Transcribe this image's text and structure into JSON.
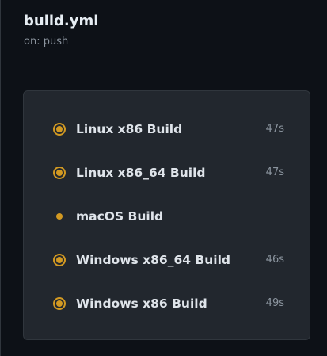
{
  "workflow": {
    "title": "build.yml",
    "trigger": "on: push"
  },
  "colors": {
    "status_in_progress": "#d29922",
    "page_background": "#0d1117",
    "card_background": "#22272e"
  },
  "jobs": [
    {
      "name": "Linux x86 Build",
      "duration": "47s",
      "status_icon": "in-progress-ring-icon"
    },
    {
      "name": "Linux x86_64 Build",
      "duration": "47s",
      "status_icon": "in-progress-ring-icon"
    },
    {
      "name": "macOS Build",
      "duration": "",
      "status_icon": "queued-dot-icon"
    },
    {
      "name": "Windows x86_64 Build",
      "duration": "46s",
      "status_icon": "in-progress-ring-icon"
    },
    {
      "name": "Windows x86 Build",
      "duration": "49s",
      "status_icon": "in-progress-ring-icon"
    }
  ]
}
